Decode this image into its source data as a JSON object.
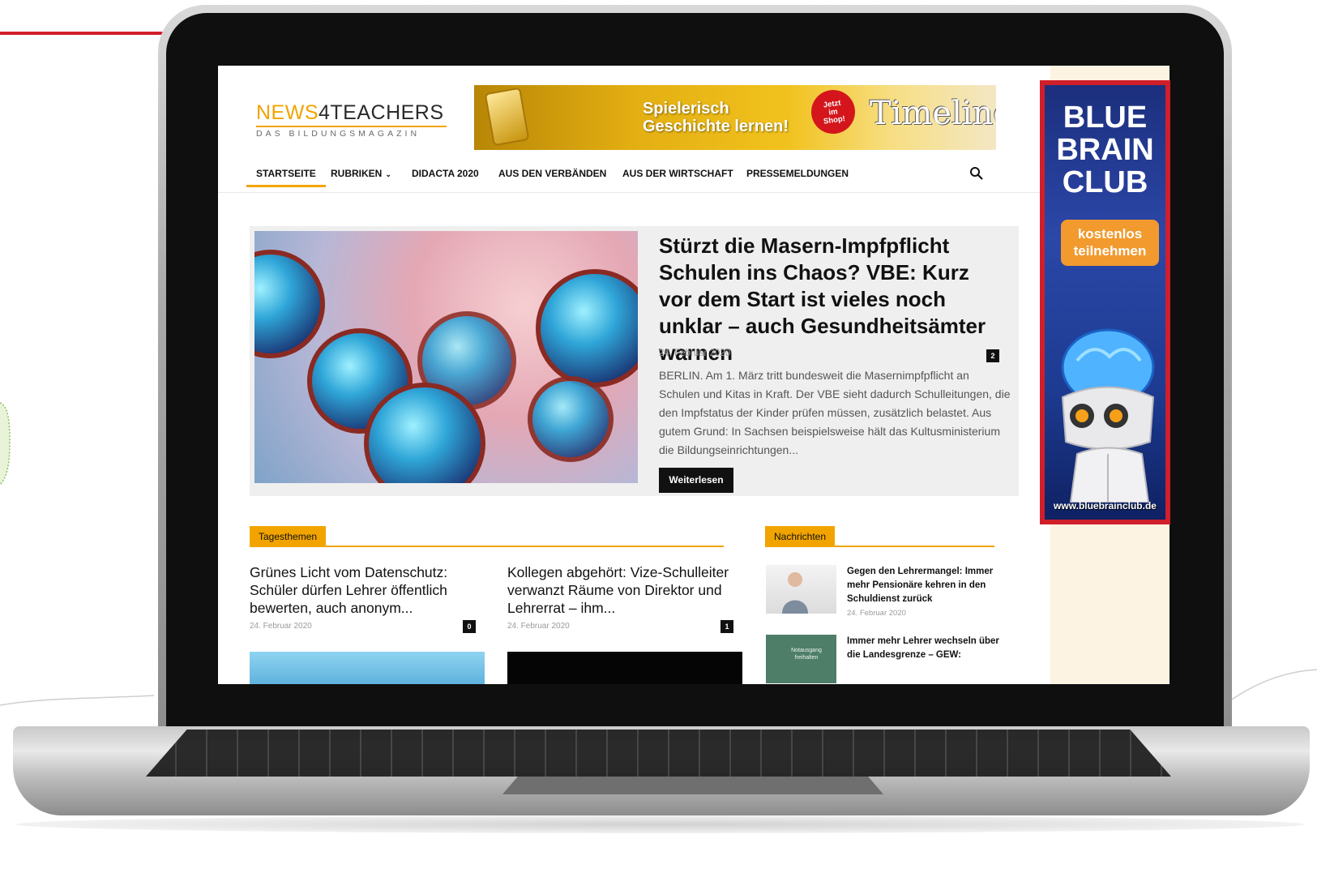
{
  "colors": {
    "accent": "#f1a400",
    "highlight_frame": "#d01f2a",
    "ad_background": "#2b47a8",
    "ad_button": "#f29a2e"
  },
  "site": {
    "logo_part1": "NEWS",
    "logo_part2": "4TEACHERS",
    "logo_tagline": "DAS BILDUNGSMAGAZIN"
  },
  "top_banner": {
    "headline_line1": "Spielerisch",
    "headline_line2": "Geschichte lernen!",
    "badge": "Jetzt\nim\nShop!",
    "brand": "Timeline"
  },
  "nav": {
    "items": [
      {
        "label": "STARTSEITE",
        "active": true
      },
      {
        "label": "RUBRIKEN",
        "has_dropdown": true
      },
      {
        "label": "DIDACTA 2020"
      },
      {
        "label": "AUS DEN VERBÄNDEN"
      },
      {
        "label": "AUS DER WIRTSCHAFT"
      },
      {
        "label": "PRESSEMELDUNGEN"
      }
    ],
    "search_icon": "search-icon"
  },
  "featured": {
    "title": "Stürzt die Masern-Impfpflicht Schulen ins Chaos? VBE: Kurz vor dem Start ist vieles noch unklar – auch Gesundheitsämter warnen",
    "date": "24. Februar 2020",
    "comments": "2",
    "excerpt": "BERLIN. Am 1. März tritt bundesweit die Masernimpfpflicht an Schulen und Kitas in Kraft. Der VBE sieht dadurch Schulleitungen, die den Impfstatus der Kinder prüfen müssen, zusätzlich belastet. Aus gutem Grund: In Sachsen beispielsweise hält das Kultusministerium die Bildungseinrichtungen...",
    "read_more": "Weiterlesen"
  },
  "tagesthemen": {
    "label": "Tagesthemen",
    "articles": [
      {
        "title": "Grünes Licht vom Datenschutz: Schüler dürfen Lehrer öffentlich bewerten, auch anonym...",
        "date": "24. Februar 2020",
        "comments": "0"
      },
      {
        "title": "Kollegen abgehört: Vize-Schulleiter verwanzt Räume von Direktor und Lehrerrat – ihm...",
        "date": "24. Februar 2020",
        "comments": "1"
      }
    ]
  },
  "nachrichten": {
    "label": "Nachrichten",
    "items": [
      {
        "title": "Gegen den Lehrermangel: Immer mehr Pensionäre kehren in den Schuldienst zurück",
        "date": "24. Februar 2020"
      },
      {
        "title": "Immer mehr Lehrer wechseln über die Landesgrenze – GEW:",
        "date": ""
      }
    ],
    "thumb_sign_line1": "Notausgang",
    "thumb_sign_line2": "freihalten"
  },
  "side_ad": {
    "title": "BLUE\nBRAIN\nCLUB",
    "cta": "kostenlos\nteilnehmen",
    "url": "www.bluebrainclub.de"
  }
}
